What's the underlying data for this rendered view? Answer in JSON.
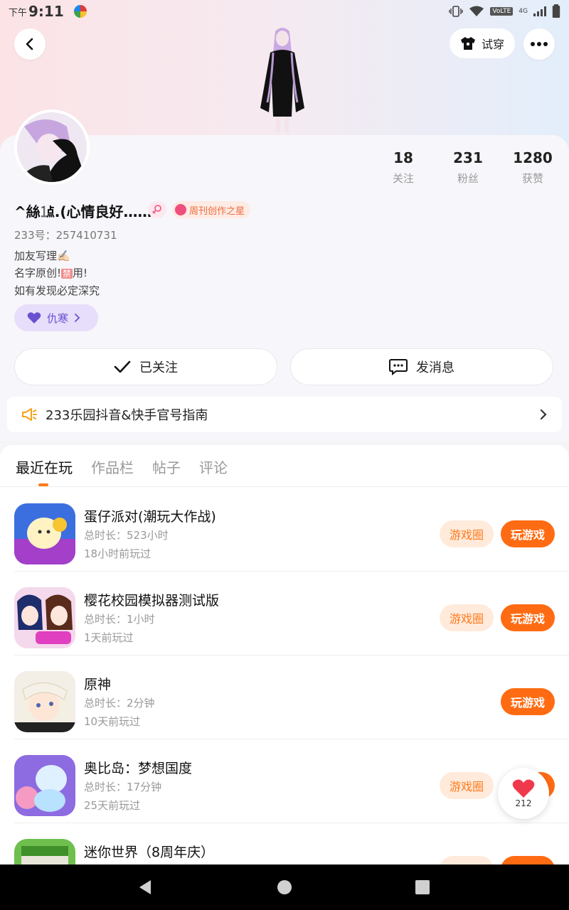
{
  "status_bar": {
    "time_prefix": "下午",
    "time": "9:11",
    "network": "4G",
    "volte": "VoLTE"
  },
  "header": {
    "try_on_label": "试穿"
  },
  "profile": {
    "username": "^絲㍙.(心情良好……",
    "star_badge": "周刊创作之星",
    "uid": "233号：257410731",
    "bio": [
      "加友写理✍🏻",
      "名字原创!",
      "用!",
      "如有发现必定深究"
    ],
    "bio_ban_char": "禁",
    "tag_label": "仇寒",
    "stats": [
      {
        "value": "18",
        "label": "关注"
      },
      {
        "value": "231",
        "label": "粉丝"
      },
      {
        "value": "1280",
        "label": "获赞"
      }
    ]
  },
  "actions": {
    "follow_label": "已关注",
    "message_label": "发消息"
  },
  "notice": {
    "text": "233乐园抖音&快手官号指南"
  },
  "tabs": [
    "最近在玩",
    "作品栏",
    "帖子",
    "评论"
  ],
  "games": [
    {
      "name": "蛋仔派对(潮玩大作战)",
      "duration": "总时长：523小时",
      "last_played": "18小时前玩过",
      "has_circle": true
    },
    {
      "name": "樱花校园模拟器测试版",
      "duration": "总时长：1小时",
      "last_played": "1天前玩过",
      "has_circle": true
    },
    {
      "name": "原神",
      "duration": "总时长：2分钟",
      "last_played": "10天前玩过",
      "has_circle": false
    },
    {
      "name": "奥比岛：梦想国度",
      "duration": "总时长：17分钟",
      "last_played": "25天前玩过",
      "has_circle": true
    },
    {
      "name": "迷你世界（8周年庆）",
      "duration": "",
      "last_played": "",
      "has_circle": true
    }
  ],
  "game_buttons": {
    "circle_label": "游戏圈",
    "play_label": "玩游戏"
  },
  "floating_like": {
    "count": "212"
  },
  "colors": {
    "accent": "#ff6b12",
    "accent_light": "#ffeadb",
    "tag_purple": "#6b4fd1"
  }
}
